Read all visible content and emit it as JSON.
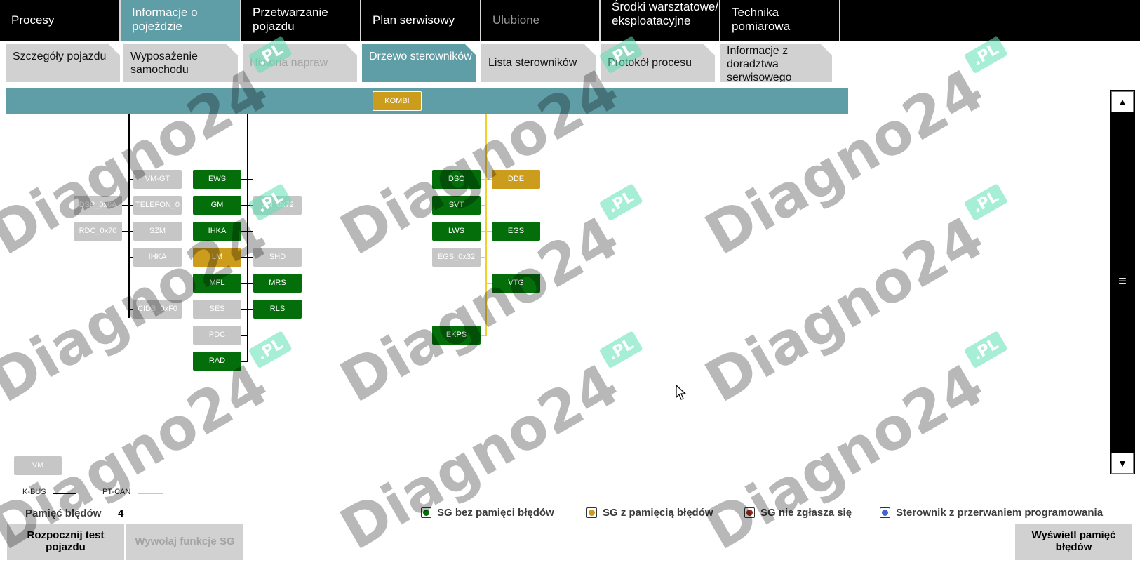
{
  "top_tabs": [
    {
      "label": "Procesy"
    },
    {
      "label": "Informacje o pojeździe"
    },
    {
      "label": "Przetwarzanie pojazdu"
    },
    {
      "label": "Plan serwisowy"
    },
    {
      "label": "Ulubione"
    },
    {
      "label": "Środki warsztatowe/ eksploatacyjne"
    },
    {
      "label": "Technika pomiarowa"
    }
  ],
  "sub_tabs": [
    {
      "label": "Szczegóły pojazdu"
    },
    {
      "label": "Wyposażenie samochodu"
    },
    {
      "label": "Historia napraw"
    },
    {
      "label": "Drzewo sterowników"
    },
    {
      "label": "Lista sterowników"
    },
    {
      "label": "Protokół procesu"
    },
    {
      "label": "Informacje z doradztwa serwisowego"
    }
  ],
  "tree": {
    "root": "KOMBI",
    "ecus": {
      "vm_gt": "VM-GT",
      "dsp": "DSP_0x6A",
      "telefon": "TELEFON_0",
      "rdc": "RDC_0x70",
      "szm": "SZM",
      "ihk_gray": "IHKA",
      "cidb": "CIDB_0xF0",
      "ews": "EWS",
      "gm": "GM",
      "ihka": "IHKA",
      "lm": "LM",
      "mfl": "MFL",
      "ses": "SES",
      "pdc": "PDC",
      "rad": "RAD",
      "sm": "SM_0x72",
      "shd": "SHD",
      "mrs": "MRS",
      "rls": "RLS",
      "dsc": "DSC",
      "dde": "DDE",
      "svt": "SVT",
      "lws": "LWS",
      "egs": "EGS",
      "egs32": "EGS_0x32",
      "vtg": "VTG",
      "ekps": "EKPS",
      "bottom_gray": "VM"
    }
  },
  "bus_legend": {
    "kbus": "K-BUS",
    "ptcan": "PT-CAN"
  },
  "fault_memory": {
    "label": "Pamięć błędów",
    "count": "4"
  },
  "legend": [
    {
      "label": "SG bez pamięci błędów",
      "color": "#046f0a"
    },
    {
      "label": "SG z pamięcią błędów",
      "color": "#cc9c1c"
    },
    {
      "label": "SG nie zgłasza się",
      "color": "#9b2a1c"
    },
    {
      "label": "Sterownik z przerwaniem programowania",
      "color": "#3f63d6"
    }
  ],
  "buttons": {
    "start_test": "Rozpocznij test pojazdu",
    "call_sg": "Wywołaj funkcje SG",
    "show_faults": "Wyświetl pamięć błędów"
  },
  "scrollbar": {
    "up_icon": "▲",
    "down_icon": "▼",
    "grip_icon": "≡"
  },
  "watermark": {
    "text": "Diagno24",
    "suffix": ".PL"
  },
  "colors": {
    "accent": "#5f9ea7",
    "ok": "#046f0a",
    "fault": "#cc9c1c",
    "absent": "#c6c6c6"
  }
}
